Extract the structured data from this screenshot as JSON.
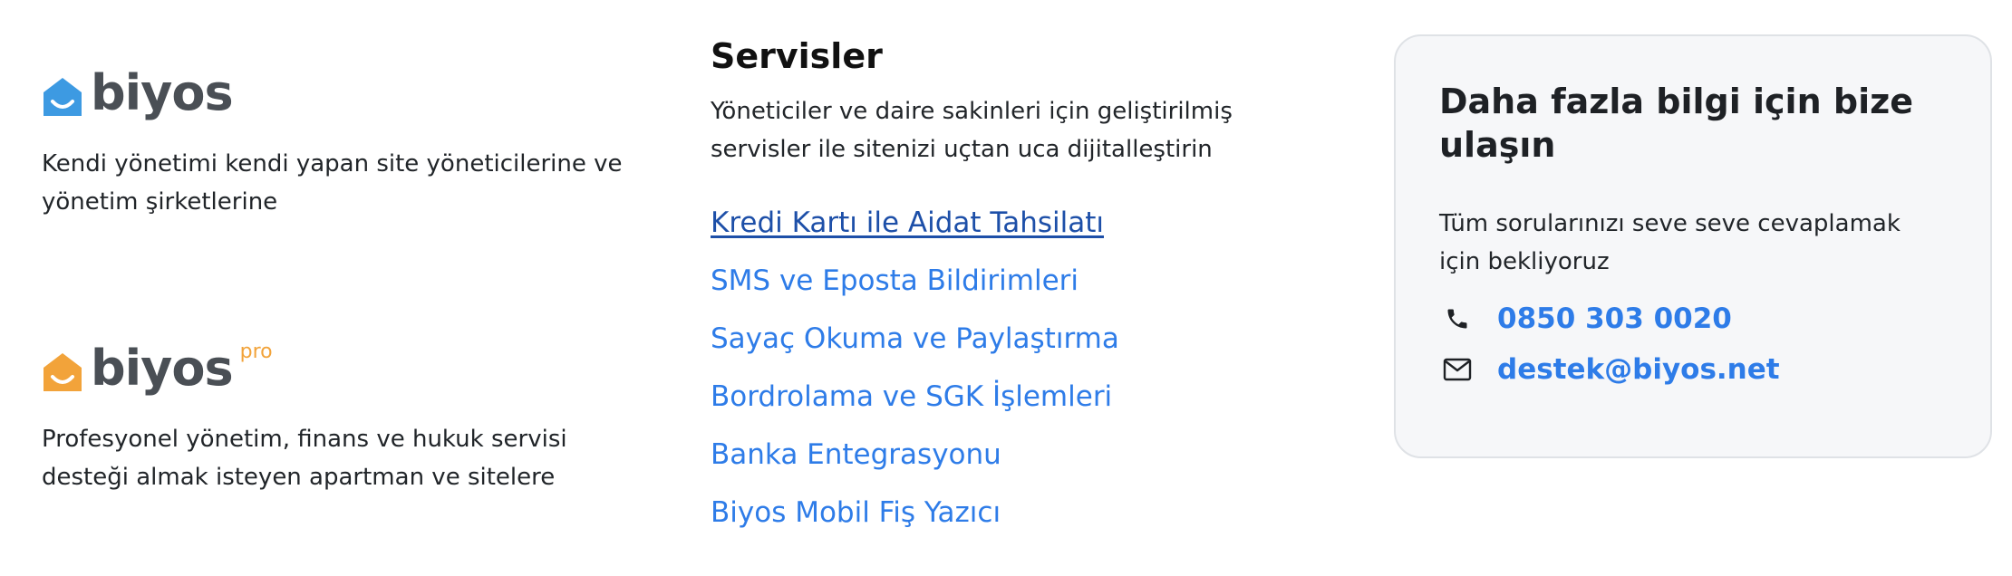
{
  "brands": [
    {
      "name": "biyos",
      "suffix": "",
      "icon_color": "#3d9ae2",
      "description": "Kendi yönetimi kendi yapan site yöneticilerine ve yönetim şirketlerine"
    },
    {
      "name": "biyos",
      "suffix": "pro",
      "icon_color": "#f2a33a",
      "description": "Profesyonel yönetim, finans ve hukuk servisi desteği almak isteyen apartman ve sitelere"
    }
  ],
  "services": {
    "title": "Servisler",
    "description": "Yöneticiler ve daire sakinleri için geliştirilmiş servisler ile sitenizi uçtan uca dijitalleştirin",
    "items": [
      {
        "label": "Kredi Kartı ile Aidat Tahsilatı",
        "active": true
      },
      {
        "label": "SMS ve Eposta Bildirimleri",
        "active": false
      },
      {
        "label": "Sayaç Okuma ve Paylaştırma",
        "active": false
      },
      {
        "label": "Bordrolama ve SGK İşlemleri",
        "active": false
      },
      {
        "label": "Banka Entegrasyonu",
        "active": false
      },
      {
        "label": "Biyos Mobil Fiş Yazıcı",
        "active": false
      }
    ]
  },
  "contact": {
    "title": "Daha fazla bilgi için bize ulaşın",
    "description": "Tüm sorularınızı seve seve cevaplamak için bekliyoruz",
    "phone": {
      "icon": "phone-icon",
      "value": "0850 303 0020"
    },
    "email": {
      "icon": "mail-icon",
      "value": "destek@biyos.net"
    }
  },
  "colors": {
    "link": "#2e7ce8",
    "link_active": "#1d4fa8",
    "brand_blue": "#3d9ae2",
    "brand_orange": "#f2a33a",
    "card_bg": "#f6f7f9"
  }
}
